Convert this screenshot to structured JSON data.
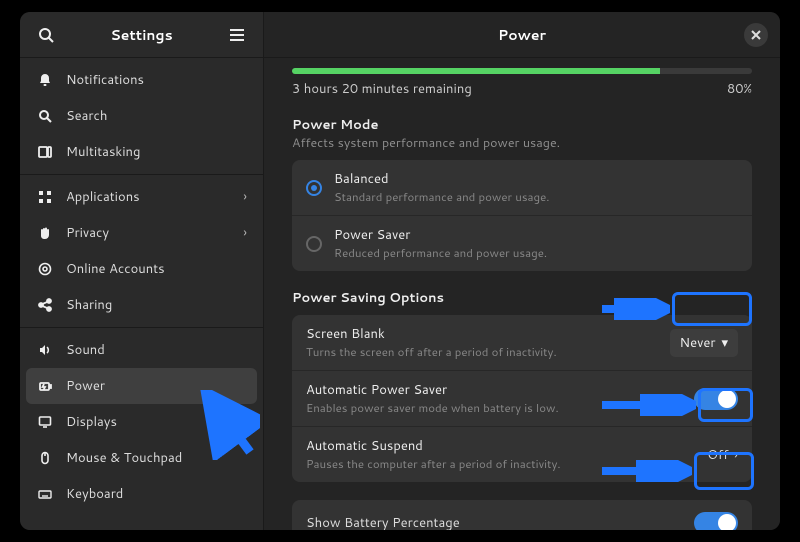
{
  "header": {
    "sidebar_title": "Settings",
    "main_title": "Power"
  },
  "sidebar": {
    "items": [
      {
        "label": "Notifications"
      },
      {
        "label": "Search"
      },
      {
        "label": "Multitasking"
      },
      {
        "label": "Applications"
      },
      {
        "label": "Privacy"
      },
      {
        "label": "Online Accounts"
      },
      {
        "label": "Sharing"
      },
      {
        "label": "Sound"
      },
      {
        "label": "Power"
      },
      {
        "label": "Displays"
      },
      {
        "label": "Mouse & Touchpad"
      },
      {
        "label": "Keyboard"
      }
    ]
  },
  "battery": {
    "percent": 80,
    "percent_label": "80%",
    "remaining": "3 hours 20 minutes remaining"
  },
  "power_mode": {
    "title": "Power Mode",
    "subtitle": "Affects system performance and power usage.",
    "options": [
      {
        "label": "Balanced",
        "sub": "Standard performance and power usage.",
        "selected": true
      },
      {
        "label": "Power Saver",
        "sub": "Reduced performance and power usage.",
        "selected": false
      }
    ]
  },
  "power_saving": {
    "title": "Power Saving Options",
    "rows": {
      "screen_blank": {
        "label": "Screen Blank",
        "sub": "Turns the screen off after a period of inactivity.",
        "value": "Never"
      },
      "auto_power_saver": {
        "label": "Automatic Power Saver",
        "sub": "Enables power saver mode when battery is low.",
        "on": true
      },
      "auto_suspend": {
        "label": "Automatic Suspend",
        "sub": "Pauses the computer after a period of inactivity.",
        "value": "Off"
      }
    }
  },
  "show_battery_pct": {
    "label": "Show Battery Percentage",
    "on": true
  }
}
